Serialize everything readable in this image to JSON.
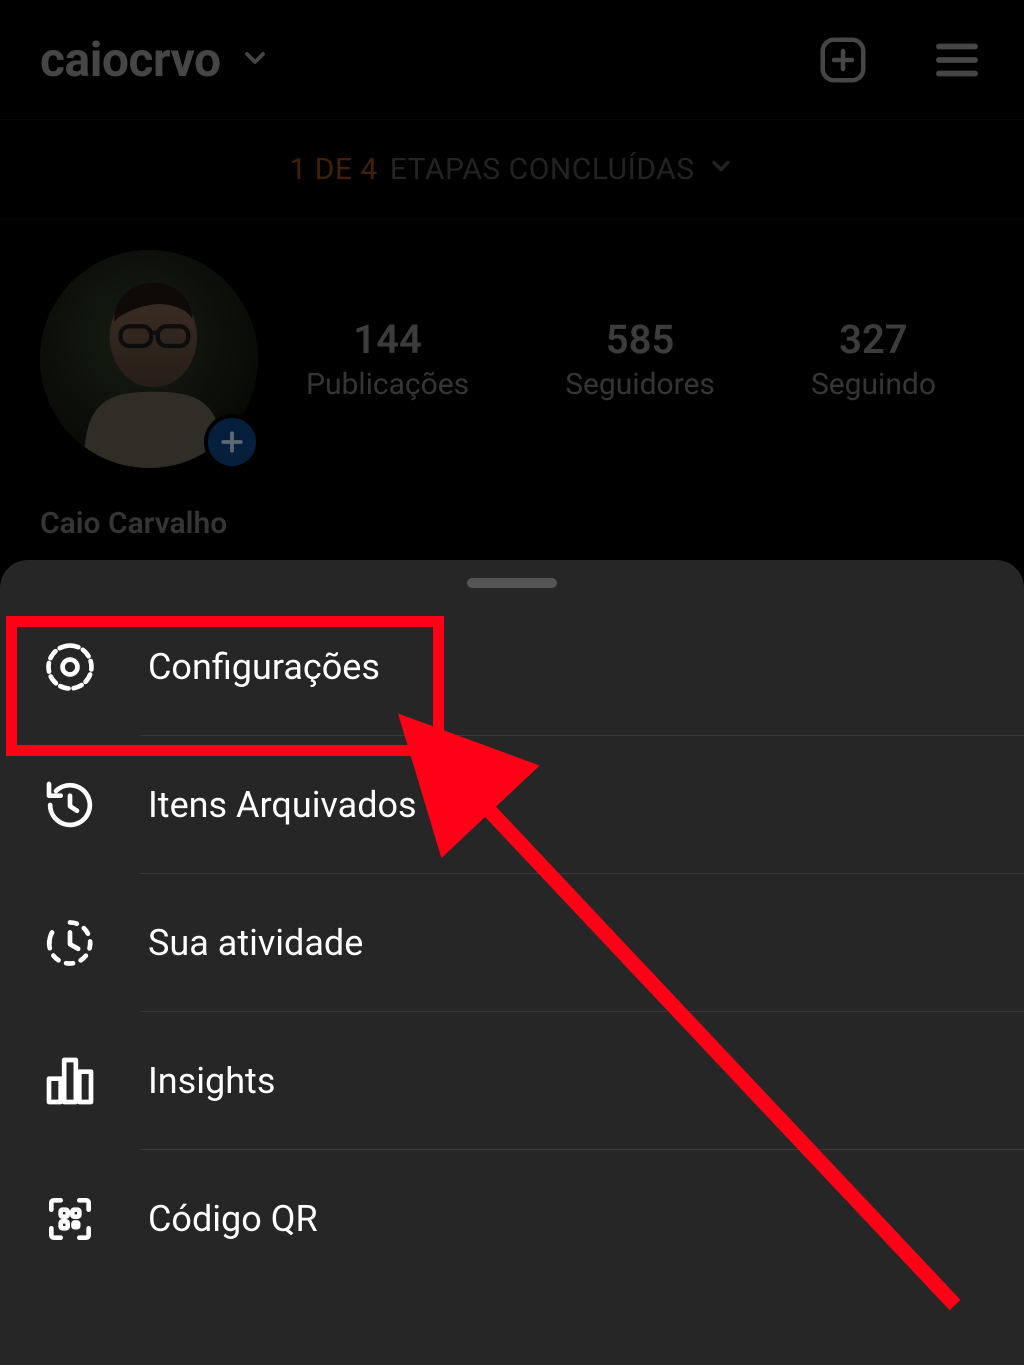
{
  "header": {
    "username": "caiocrvo",
    "create_icon": "plus-square-icon",
    "menu_icon": "hamburger-icon"
  },
  "progress": {
    "count_text": "1 DE 4",
    "status_text": "ETAPAS CONCLUÍDAS"
  },
  "profile": {
    "display_name": "Caio Carvalho",
    "add_story_icon": "plus-icon",
    "stats": {
      "posts": {
        "count": "144",
        "label": "Publicações"
      },
      "followers": {
        "count": "585",
        "label": "Seguidores"
      },
      "following": {
        "count": "327",
        "label": "Seguindo"
      }
    }
  },
  "sheet": {
    "items": [
      {
        "icon": "gear-icon",
        "label": "Configurações"
      },
      {
        "icon": "archive-icon",
        "label": "Itens Arquivados"
      },
      {
        "icon": "activity-icon",
        "label": "Sua atividade"
      },
      {
        "icon": "insights-icon",
        "label": "Insights"
      },
      {
        "icon": "qr-icon",
        "label": "Código QR"
      }
    ]
  },
  "annotation": {
    "highlight_color": "#ff0017",
    "arrow_color": "#ff0017"
  }
}
